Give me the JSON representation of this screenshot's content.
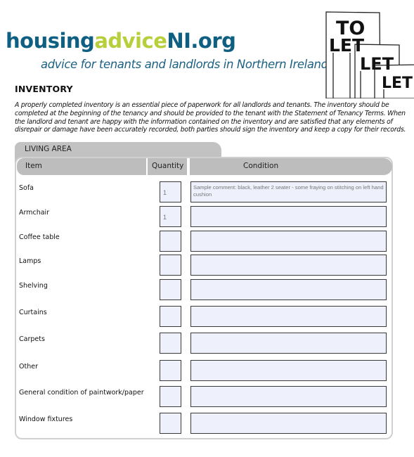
{
  "logo": {
    "part1": "housing",
    "part2": "advice",
    "part3": "NI.org"
  },
  "tagline": "advice for tenants and landlords in Northern Ireland",
  "sign_image": {
    "lines": [
      "TO",
      "LET",
      "LET",
      "LET"
    ],
    "icon": "to-let-signs-illustration"
  },
  "title": "INVENTORY",
  "intro": "A properly completed inventory is an essential piece of paperwork for all landlords and tenants.  The inventory should be completed at the beginning of the tenancy and should be provided to the tenant with the Statement of Tenancy Terms.  When the landlord and tenant are happy with the information contained on the inventory and are satisfied that any elements of disrepair or damage have been accurately recorded, both parties should sign the inventory and keep a copy for their records.",
  "section": {
    "title": "LIVING AREA",
    "columns": {
      "item": "Item",
      "quantity": "Quantity",
      "condition": "Condition"
    },
    "rows": [
      {
        "item": "Sofa",
        "quantity": "1",
        "condition": "Sample comment: black, leather 2 seater - some fraying on stitching on left hand cushion"
      },
      {
        "item": "Armchair",
        "quantity": "1",
        "condition": ""
      },
      {
        "item": "Coffee table",
        "quantity": "",
        "condition": ""
      },
      {
        "item": "Lamps",
        "quantity": "",
        "condition": ""
      },
      {
        "item": "Shelving",
        "quantity": "",
        "condition": ""
      },
      {
        "item": "Curtains",
        "quantity": "",
        "condition": ""
      },
      {
        "item": "Carpets",
        "quantity": "",
        "condition": ""
      },
      {
        "item": "Other",
        "quantity": "",
        "condition": ""
      },
      {
        "item": "General condition of paintwork/paper",
        "quantity": "",
        "condition": ""
      },
      {
        "item": "Window fixtures",
        "quantity": "",
        "condition": ""
      }
    ]
  }
}
